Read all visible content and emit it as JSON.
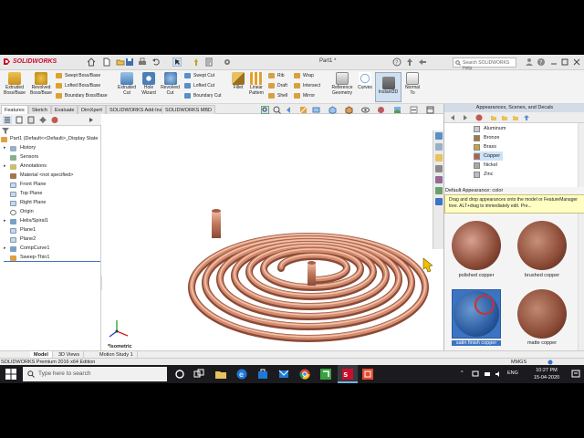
{
  "app": {
    "brand": "SOLIDWORKS",
    "document_title": "Part1 *",
    "search_placeholder": "Search SOLIDWORKS Help"
  },
  "command_manager": {
    "big": [
      {
        "id": "extruded-boss",
        "label": "Extruded Boss/Base"
      },
      {
        "id": "revolved-boss",
        "label": "Revolved Boss/Base"
      },
      {
        "id": "extruded-cut",
        "label": "Extruded Cut"
      },
      {
        "id": "hole-wizard",
        "label": "Hole Wizard"
      },
      {
        "id": "revolved-cut",
        "label": "Revolved Cut"
      },
      {
        "id": "fillet",
        "label": "Fillet"
      },
      {
        "id": "linear-pattern",
        "label": "Linear Pattern"
      },
      {
        "id": "reference-geometry",
        "label": "Reference Geometry"
      },
      {
        "id": "curves",
        "label": "Curves"
      },
      {
        "id": "instant3d",
        "label": "Instant3D"
      },
      {
        "id": "normal-to",
        "label": "Normal To"
      }
    ],
    "boss_rows": [
      "Swept Boss/Base",
      "Lofted Boss/Base",
      "Boundary Boss/Base"
    ],
    "cut_rows": [
      "Swept Cut",
      "Lofted Cut",
      "Boundary Cut"
    ],
    "feature_rows": [
      "Rib",
      "Draft",
      "Shell"
    ],
    "misc_rows": [
      "Wrap",
      "Intersect",
      "Mirror"
    ]
  },
  "tabs": [
    "Features",
    "Sketch",
    "Evaluate",
    "DimXpert",
    "SOLIDWORKS Add-Ins",
    "SOLIDWORKS MBD"
  ],
  "feature_tree": {
    "root": "Part1  (Default<<Default>_Display State",
    "items": [
      "History",
      "Sensors",
      "Annotations",
      "Material <not specified>",
      "Front Plane",
      "Top Plane",
      "Right Plane",
      "Origin",
      "Helix/Spiral1",
      "Plane1",
      "Plane2",
      "CompCurve1",
      "Sweep-Thin1"
    ]
  },
  "view": {
    "orientation_label": "*Isometric"
  },
  "appearances_panel": {
    "title": "Appearances, Scenes, and Decals",
    "materials": [
      "Aluminum",
      "Bronze",
      "Brass",
      "Copper",
      "Nickel",
      "Zinc"
    ],
    "selected_material": "Copper",
    "caption": "Default Appearance: color",
    "tip": "Drag and drop appearances onto the model or FeatureManager tree.  ALT+drag to immediately edit.  Pre...",
    "thumbnails": [
      "polished copper",
      "brushed copper",
      "satin finish copper",
      "matte copper"
    ],
    "selected_thumbnail": "satin finish copper"
  },
  "bottom_tabs": [
    "Model",
    "3D Views",
    "Motion Study 1"
  ],
  "status": {
    "left": "SOLIDWORKS Premium 2016 x64 Edition",
    "units": "MMGS"
  },
  "taskbar": {
    "search_placeholder": "Type here to search",
    "language": "ENG",
    "time": "10:27 PM",
    "date": "15-04-2020"
  },
  "colors": {
    "copper": "#b4614a",
    "copper_light": "#e2a68c",
    "selection_blue": "#3b74c4",
    "brand_red": "#c8102e"
  }
}
